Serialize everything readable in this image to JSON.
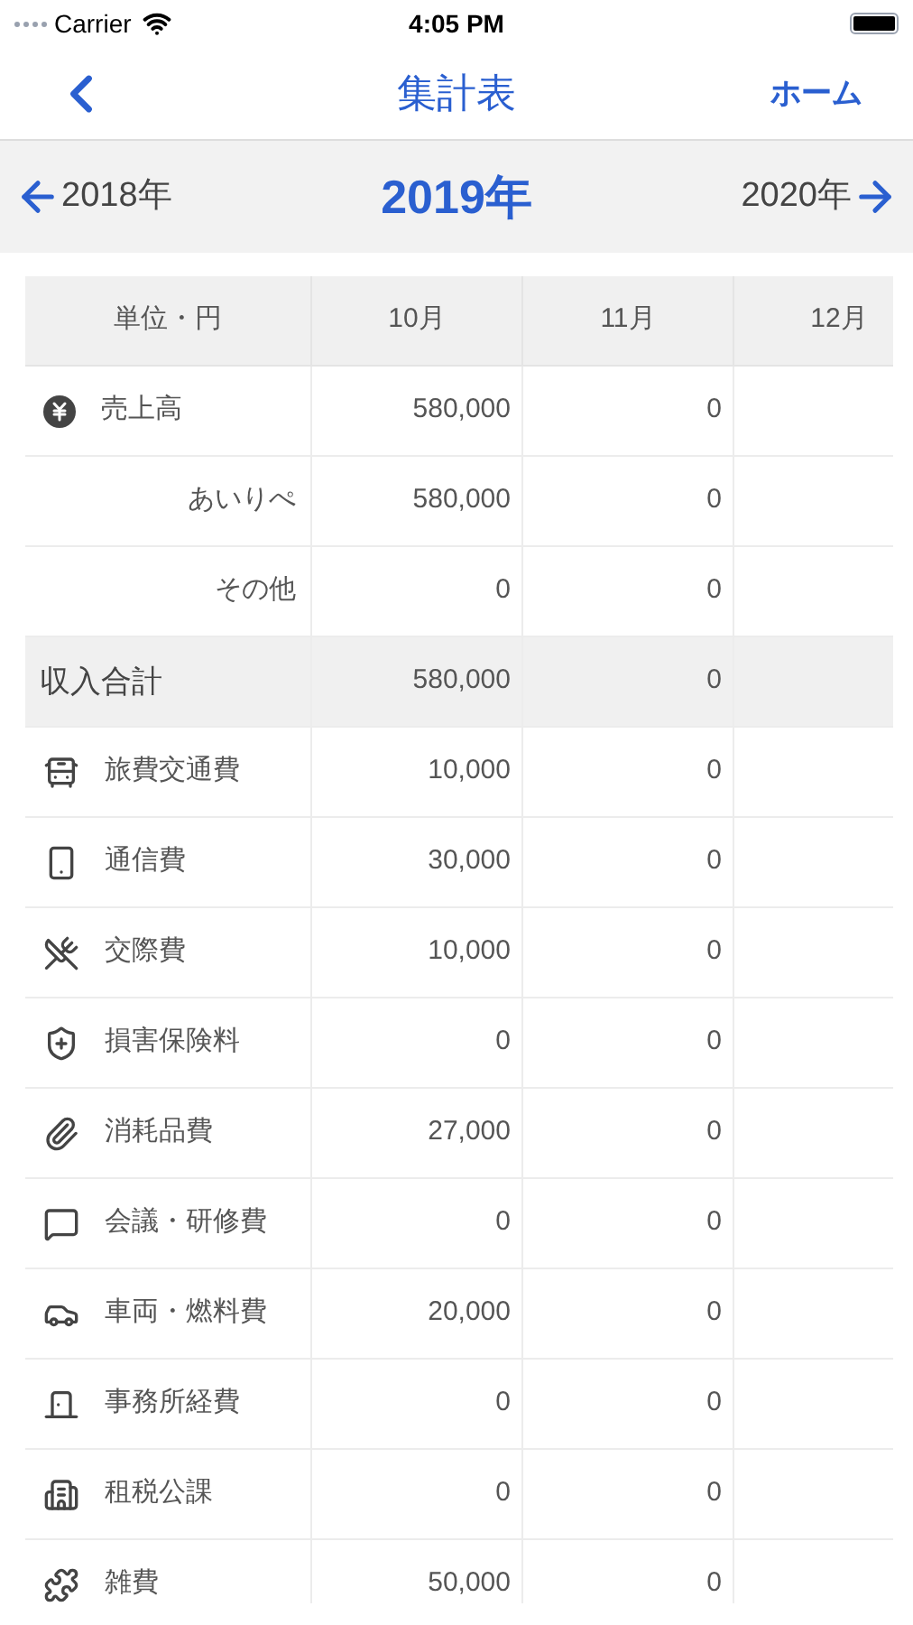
{
  "status_bar": {
    "carrier": "Carrier",
    "time": "4:05 PM"
  },
  "nav": {
    "title": "集計表",
    "right_button": "ホーム"
  },
  "year_bar": {
    "prev": "2018年",
    "current": "2019年",
    "next": "2020年"
  },
  "table": {
    "columns": [
      "単位・円",
      "10月",
      "11月",
      "12月"
    ],
    "rows": [
      {
        "kind": "category",
        "label": "売上高",
        "values": [
          "580,000",
          "0"
        ]
      },
      {
        "kind": "sub",
        "label": "あいりぺ",
        "values": [
          "580,000",
          "0"
        ]
      },
      {
        "kind": "sub",
        "label": "その他",
        "values": [
          "0",
          "0"
        ]
      },
      {
        "kind": "total",
        "label": "収入合計",
        "values": [
          "580,000",
          "0"
        ]
      },
      {
        "kind": "category",
        "label": "旅費交通費",
        "values": [
          "10,000",
          "0"
        ]
      },
      {
        "kind": "category",
        "label": "通信費",
        "values": [
          "30,000",
          "0"
        ]
      },
      {
        "kind": "category",
        "label": "交際費",
        "values": [
          "10,000",
          "0"
        ]
      },
      {
        "kind": "category",
        "label": "損害保険料",
        "values": [
          "0",
          "0"
        ]
      },
      {
        "kind": "category",
        "label": "消耗品費",
        "values": [
          "27,000",
          "0"
        ]
      },
      {
        "kind": "category",
        "label": "会議・研修費",
        "values": [
          "0",
          "0"
        ]
      },
      {
        "kind": "category",
        "label": "車両・燃料費",
        "values": [
          "20,000",
          "0"
        ]
      },
      {
        "kind": "category",
        "label": "事務所経費",
        "values": [
          "0",
          "0"
        ]
      },
      {
        "kind": "category",
        "label": "租税公課",
        "values": [
          "0",
          "0"
        ]
      },
      {
        "kind": "category",
        "label": "雑費",
        "values": [
          "50,000",
          "0"
        ]
      }
    ]
  }
}
